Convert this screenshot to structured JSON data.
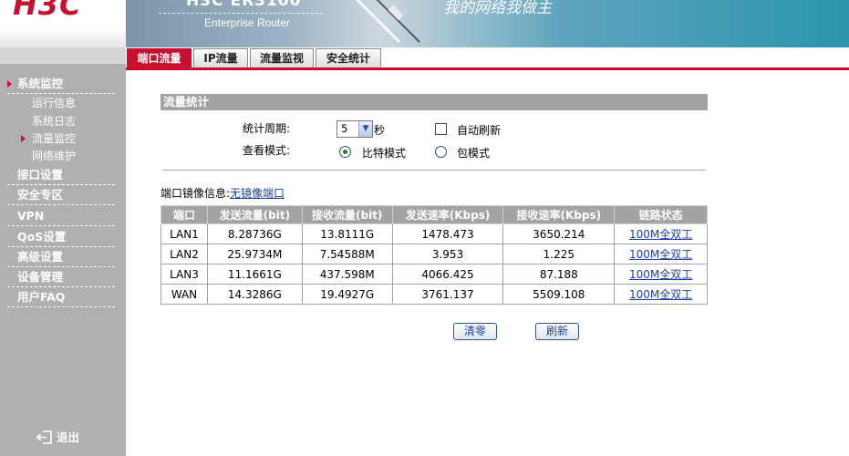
{
  "header": {
    "logo": "H3C",
    "model": "H3C  ER3100",
    "subtitle": "Enterprise Router",
    "slogan": "我的网络我做主"
  },
  "sidebar": {
    "items": [
      {
        "label": "系统监控",
        "active": true
      },
      {
        "label": "接口设置"
      },
      {
        "label": "安全专区"
      },
      {
        "label": "VPN"
      },
      {
        "label": "QoS设置"
      },
      {
        "label": "高级设置"
      },
      {
        "label": "设备管理"
      },
      {
        "label": "用户FAQ"
      }
    ],
    "subitems": [
      {
        "label": "运行信息"
      },
      {
        "label": "系统日志"
      },
      {
        "label": "流量监控",
        "active": true
      },
      {
        "label": "网络维护"
      }
    ],
    "logout": "退出"
  },
  "tabs": [
    {
      "label": "端口流量",
      "active": true
    },
    {
      "label": "IP流量"
    },
    {
      "label": "流量监视"
    },
    {
      "label": "安全统计"
    }
  ],
  "stats": {
    "section_title": "流量统计",
    "period_label": "统计周期:",
    "period_value": "5",
    "period_unit": "秒",
    "auto_refresh_label": "自动刷新",
    "auto_refresh_checked": false,
    "view_mode_label": "查看模式:",
    "mode_bit": "比特模式",
    "mode_packet": "包模式",
    "selected_mode": "比特模式"
  },
  "mirror": {
    "label": "端口镜像信息:",
    "link": "无镜像端口"
  },
  "table": {
    "headers": [
      "端口",
      "发送流量(bit)",
      "接收流量(bit)",
      "发送速率(Kbps)",
      "接收速率(Kbps)",
      "链路状态"
    ],
    "rows": [
      [
        "LAN1",
        "8.28736G",
        "13.8111G",
        "1478.473",
        "3650.214",
        "100M全双工"
      ],
      [
        "LAN2",
        "25.9734M",
        "7.54588M",
        "3.953",
        "1.225",
        "100M全双工"
      ],
      [
        "LAN3",
        "11.1661G",
        "437.598M",
        "4066.425",
        "87.188",
        "100M全双工"
      ],
      [
        "WAN",
        "14.3286G",
        "19.4927G",
        "3761.137",
        "5509.108",
        "100M全双工"
      ]
    ]
  },
  "buttons": {
    "clear": "清零",
    "refresh": "刷新"
  },
  "colors": {
    "brand_red": "#c8102e",
    "sidebar_gray": "#b0b0b0",
    "header_gray": "#a3a3a3",
    "link_blue": "#1b3fa0"
  }
}
